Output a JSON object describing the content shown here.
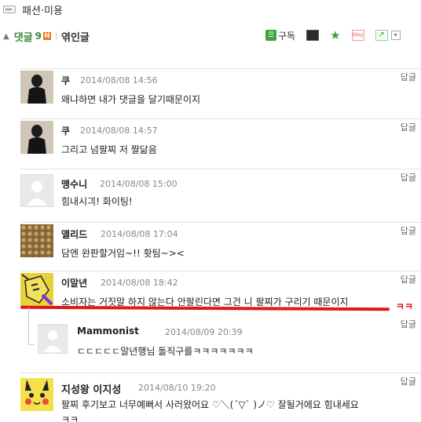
{
  "category": {
    "label": "패션·미용",
    "icon": "folder-icon"
  },
  "toolbar": {
    "comments_label": "댓글",
    "comments_count": "9",
    "new_badge": "N",
    "related_label": "엮인글",
    "subscribe_label": "구독"
  },
  "comments": [
    {
      "nick": "쿠",
      "date": "2014/08/08 14:56",
      "text": "왜냐하면 내가 댓글을 달기때문이지",
      "reply_label": "답글",
      "avatar": "dark-figure-avatar"
    },
    {
      "nick": "쿠",
      "date": "2014/08/08 14:57",
      "text": "그리고 넘팔찌 저 짤닮음",
      "reply_label": "답글",
      "avatar": "dark-figure-avatar"
    },
    {
      "nick": "맹수니",
      "date": "2014/08/08 15:00",
      "text": "힘내시긔! 화이팅!",
      "reply_label": "답글",
      "avatar": "default-avatar"
    },
    {
      "nick": "앨리드",
      "date": "2014/08/08 17:04",
      "text": "담엔 완판할거임~!! 홧팀~><",
      "reply_label": "답글",
      "avatar": "pattern-avatar"
    },
    {
      "nick": "이말년",
      "date": "2014/08/08 18:42",
      "text": "소비자는 거짓말 하지 않는다 안팔린다면 그건 니 팔찌가 구리기 때문이지",
      "extra": "ㅋㅋ",
      "reply_label": "답글",
      "avatar": "cartoon-avatar"
    },
    {
      "nick": "Mammonist",
      "date": "2014/08/09 20:39",
      "text": "ㄷㄷㄷㄷㄷ말년행님 돌직구를ㅋㅋㅋㅋㅋㅋㅋ",
      "reply_label": "답글",
      "avatar": "default-avatar"
    },
    {
      "nick": "지성왕 이지성",
      "date": "2014/08/10 19:20",
      "text": "팔찌 후기보고 너무예뻐서 사러왔어요 ♡＼(´▽` )ノ♡ 잘될거에요 힘내세요",
      "text2": "ㅋㅋ",
      "reply_label": "답글",
      "avatar": "pikachu-avatar"
    }
  ],
  "colors": {
    "accent_green": "#3b8a3b",
    "highlight_red": "#e01818"
  }
}
